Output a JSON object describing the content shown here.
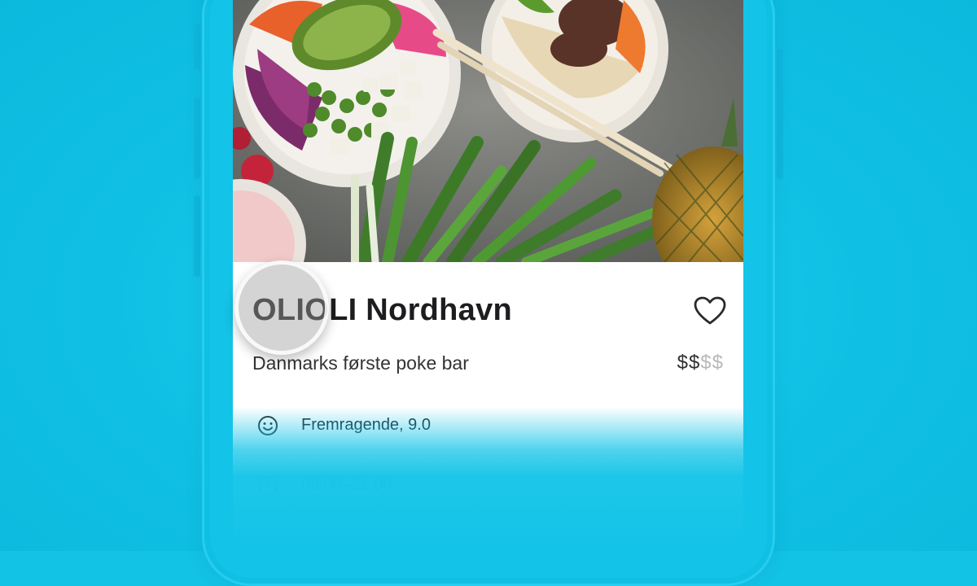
{
  "restaurant": {
    "name": "OLIOLI Nordhavn",
    "tagline": "Danmarks første poke bar",
    "price_level": {
      "active": "$$",
      "inactive": "$$"
    }
  },
  "info_rows": [
    {
      "icon": "smiley-icon",
      "text": "Fremragende, 9.0"
    },
    {
      "icon": "clock-icon",
      "text": "08.00–21.00",
      "action": "Mere info"
    }
  ],
  "colors": {
    "background": "#12c3e6",
    "accent": "#1ec9ec",
    "title": "#1d1d1f"
  }
}
